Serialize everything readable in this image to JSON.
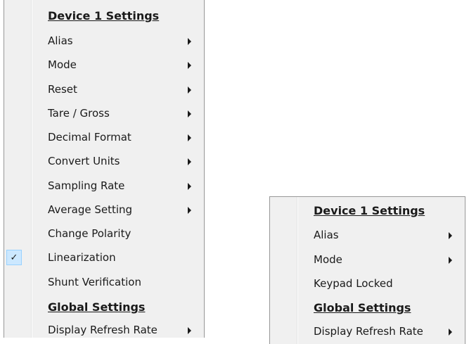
{
  "menu_left": {
    "items": [
      {
        "label": "Device 1 Settings",
        "type": "heading"
      },
      {
        "label": "Alias",
        "submenu": true
      },
      {
        "label": "Mode",
        "submenu": true
      },
      {
        "label": "Reset",
        "submenu": true
      },
      {
        "label": "Tare / Gross",
        "submenu": true
      },
      {
        "label": "Decimal Format",
        "submenu": true
      },
      {
        "label": "Convert Units",
        "submenu": true
      },
      {
        "label": "Sampling Rate",
        "submenu": true
      },
      {
        "label": "Average Setting",
        "submenu": true
      },
      {
        "label": "Change Polarity",
        "submenu": false
      },
      {
        "label": "Linearization",
        "submenu": false,
        "checked": true,
        "check_glyph": "✓"
      },
      {
        "label": "Shunt Verification",
        "submenu": false
      },
      {
        "label": "Global Settings",
        "type": "heading"
      },
      {
        "label": "Display Refresh Rate",
        "submenu": true
      }
    ]
  },
  "menu_right": {
    "items": [
      {
        "label": "Device 1 Settings",
        "type": "heading"
      },
      {
        "label": "Alias",
        "submenu": true
      },
      {
        "label": "Mode",
        "submenu": true
      },
      {
        "label": "Keypad Locked",
        "submenu": false
      },
      {
        "label": "Global Settings",
        "type": "heading"
      },
      {
        "label": "Display Refresh Rate",
        "submenu": true
      }
    ]
  },
  "colors": {
    "menu_background": "#f0f0f0",
    "menu_border": "#979797",
    "check_highlight": "#cce8ff"
  }
}
